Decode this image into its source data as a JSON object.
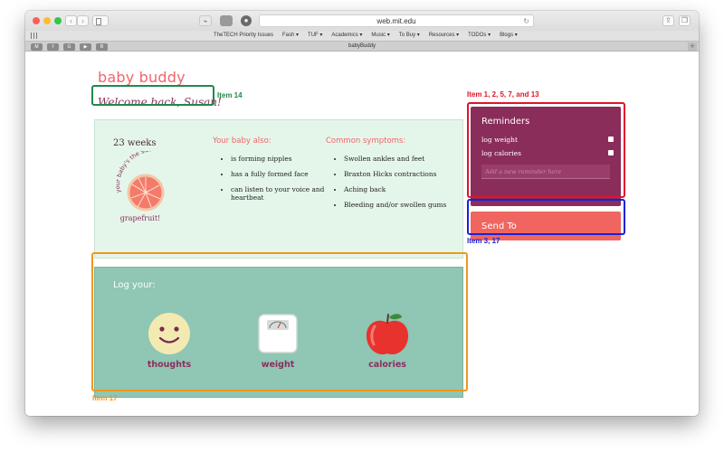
{
  "browser": {
    "url": "web.mit.edu",
    "tab_title": "babyBuddy",
    "back_icon": "‹",
    "forward_icon": "›",
    "bookmarks": [
      "TheTECH Priority Issues",
      "Fash ▾",
      "TUF ▾",
      "Academics ▾",
      "Music ▾",
      "To Buy ▾",
      "Resources ▾",
      "TODOs ▾",
      "Blogs ▾"
    ],
    "pinned_tabs": [
      "M",
      "f",
      "G",
      "▶",
      "B"
    ]
  },
  "app": {
    "logo": "baby buddy",
    "welcome": "Welcome back, Susan!"
  },
  "info": {
    "weeks": "23 weeks",
    "fruit_caption": "your baby's the size of a",
    "fruit_name": "grapefruit!",
    "col1_heading": "Your baby also:",
    "col1_items": [
      "is forming nipples",
      "has a fully formed face",
      "can listen to your voice and heartbeat"
    ],
    "col2_heading": "Common symptoms:",
    "col2_items": [
      "Swollen ankles and feet",
      "Braxton Hicks contractions",
      "Aching back",
      "Bleeding and/or swollen gums"
    ]
  },
  "log": {
    "title": "Log your:",
    "items": [
      {
        "label": "thoughts",
        "icon": "smiley-face-icon"
      },
      {
        "label": "weight",
        "icon": "scale-icon"
      },
      {
        "label": "calories",
        "icon": "apple-icon"
      }
    ]
  },
  "reminders": {
    "title": "Reminders",
    "items": [
      "log weight",
      "log calories"
    ],
    "input_placeholder": "Add a new reminder here"
  },
  "send_to": {
    "label": "Send To"
  },
  "annotations": {
    "welcome_label": "Item 14",
    "reminders_label": "Item 1, 2, 5, 7, and 13",
    "sendto_label": "Item 3, 17",
    "log_label": "Item 17"
  },
  "colors": {
    "brand": "#f0656a",
    "plum": "#8a2d5a",
    "mint": "#e4f6ea",
    "teal": "#8fc6b4",
    "annotation_green": "#1e8a4a",
    "annotation_red": "#e0142a",
    "annotation_blue": "#1a22d6",
    "annotation_orange": "#f0961e"
  }
}
